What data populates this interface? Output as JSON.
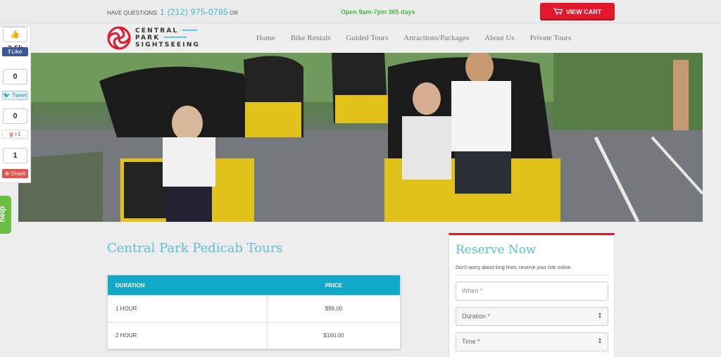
{
  "topbar": {
    "question": "HAVE QUESTIONS:",
    "phone": "1 (212) 975-0785",
    "or": "OR",
    "hours": "Open 9am-7pm 365 days",
    "cart_label": "VIEW CART"
  },
  "logo": {
    "line1": "CENTRAL",
    "line2": "PARK",
    "line3": "SIGHTSEEING"
  },
  "nav": [
    "Home",
    "Bike Rentals",
    "Guided Tours",
    "Attractions/Packages",
    "About Us",
    "Private Tours"
  ],
  "social": {
    "fb_count": "3.5k",
    "fb_label": "Like",
    "tw_count": "0",
    "tw_label": "Tweet",
    "gp_count": "0",
    "gp_label": "+1",
    "share_count": "1",
    "share_label": "Share",
    "help": "help"
  },
  "main": {
    "title": "Central Park Pedicab Tours",
    "table": {
      "headers": [
        "DURATION",
        "PRICE"
      ],
      "rows": [
        {
          "duration": "1 HOUR",
          "price": "$99.00"
        },
        {
          "duration": "2 HOUR",
          "price": "$160.00"
        }
      ]
    }
  },
  "reserve": {
    "title": "Reserve Now",
    "subtitle": "Don't worry about long lines, reserve your ride online",
    "when_placeholder": "When *",
    "duration_value": "Duration *",
    "time_value": "Time *"
  },
  "colors": {
    "accent": "#5bbfd9",
    "cart": "#e3182d",
    "table_header": "#12a9c9",
    "hours": "#4cb84a"
  }
}
